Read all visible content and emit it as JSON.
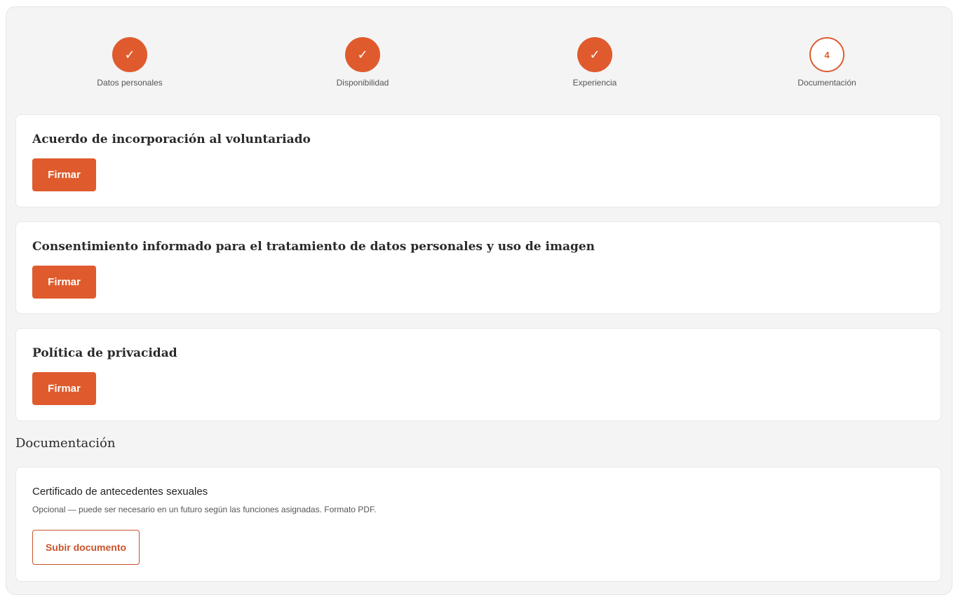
{
  "stepper": {
    "steps": [
      {
        "label": "Datos personales",
        "state": "done",
        "mark": "✓"
      },
      {
        "label": "Disponibilidad",
        "state": "done",
        "mark": "✓"
      },
      {
        "label": "Experiencia",
        "state": "done",
        "mark": "✓"
      },
      {
        "label": "Documentación",
        "state": "current",
        "mark": "4"
      }
    ]
  },
  "agreements": [
    {
      "title": "Acuerdo de incorporación al voluntariado",
      "button_label": "Firmar"
    },
    {
      "title": "Consentimiento informado para el tratamiento de datos personales y uso de imagen",
      "button_label": "Firmar"
    },
    {
      "title": "Política de privacidad",
      "button_label": "Firmar"
    }
  ],
  "documentation": {
    "heading": "Documentación",
    "items": [
      {
        "title": "Certificado de antecedentes sexuales",
        "description": "Opcional — puede ser necesario en un futuro según las funciones asignadas. Formato PDF.",
        "button_label": "Subir documento"
      }
    ]
  },
  "colors": {
    "accent": "#df5b2d",
    "background": "#f4f4f4",
    "card": "#ffffff"
  },
  "icons": {
    "done_step": "check-icon"
  }
}
